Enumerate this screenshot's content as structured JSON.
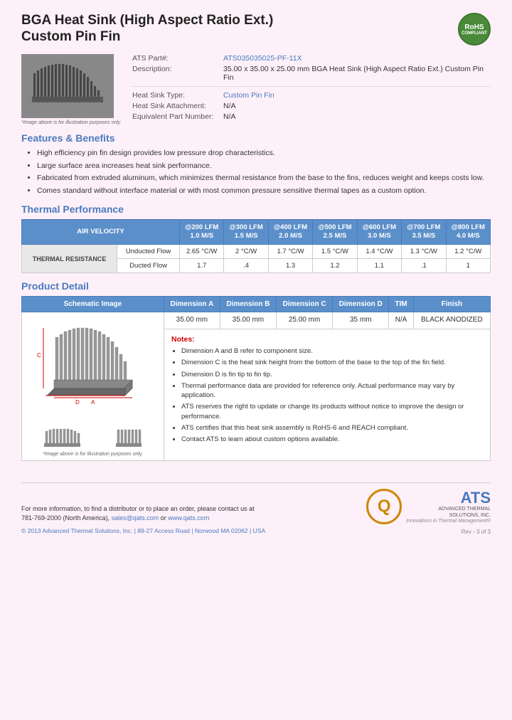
{
  "page": {
    "title_line1": "BGA Heat Sink (High Aspect Ratio Ext.)",
    "title_line2": "Custom Pin Fin"
  },
  "rohs": {
    "line1": "RoHS",
    "line2": "COMPLIANT"
  },
  "product": {
    "part_label": "ATS Part#:",
    "part_value": "ATS035035025-PF-11X",
    "desc_label": "Description:",
    "desc_value": "35.00 x 35.00 x 25.00 mm  BGA Heat Sink (High Aspect Ratio Ext.) Custom Pin Fin",
    "type_label": "Heat Sink Type:",
    "type_value": "Custom Pin Fin",
    "attachment_label": "Heat Sink Attachment:",
    "attachment_value": "N/A",
    "equiv_label": "Equivalent Part Number:",
    "equiv_value": "N/A"
  },
  "image_caption": "*Image above is for illustration purposes only",
  "features": {
    "title": "Features & Benefits",
    "items": [
      "High efficiency pin fin design provides low pressure drop characteristics.",
      "Large surface area increases heat sink performance.",
      "Fabricated from extruded aluminum, which minimizes thermal resistance from the base to the fins, reduces weight and keeps costs low.",
      "Comes standard without interface material or with most common pressure sensitive thermal tapes as a custom option."
    ]
  },
  "thermal": {
    "title": "Thermal Performance",
    "air_velocity_label": "AIR VELOCITY",
    "columns": [
      {
        "label": "@200 LFM",
        "sub": "1.0 M/S"
      },
      {
        "label": "@300 LFM",
        "sub": "1.5 M/S"
      },
      {
        "label": "@400 LFM",
        "sub": "2.0 M/S"
      },
      {
        "label": "@500 LFM",
        "sub": "2.5 M/S"
      },
      {
        "label": "@600 LFM",
        "sub": "3.0 M/S"
      },
      {
        "label": "@700 LFM",
        "sub": "3.5 M/S"
      },
      {
        "label": "@800 LFM",
        "sub": "4.0 M/S"
      }
    ],
    "row_label": "THERMAL RESISTANCE",
    "subrow1_label": "Unducted Flow",
    "subrow1_values": [
      "2.65 °C/W",
      "2 °C/W",
      "1.7 °C/W",
      "1.5 °C/W",
      "1.4 °C/W",
      "1.3 °C/W",
      "1.2 °C/W"
    ],
    "subrow2_label": "Ducted Flow",
    "subrow2_values": [
      "1.7",
      ".4",
      "1.3",
      "1.2",
      "1.1",
      ".1",
      "1"
    ]
  },
  "product_detail": {
    "title": "Product Detail",
    "headers": [
      "Schematic Image",
      "Dimension A",
      "Dimension B",
      "Dimension C",
      "Dimension D",
      "TIM",
      "Finish"
    ],
    "values": [
      "35.00 mm",
      "35.00 mm",
      "25.00 mm",
      "35 mm",
      "N/A",
      "BLACK ANODIZED"
    ],
    "schematic_caption": "*Image above is for illustration purposes only.",
    "notes_title": "Notes:",
    "notes": [
      "Dimension A and B refer to component size.",
      "Dimension C is the heat sink height from the bottom of the base to the top of the fin field.",
      "Dimension D is fin tip to fin tip.",
      "Thermal performance data are provided for reference only. Actual performance may vary by application.",
      "ATS reserves the right to update or change its products without notice to improve the design or performance.",
      "ATS certifies that this heat sink assembly is RoHS-6 and REACH compliant.",
      "Contact ATS to learn about custom options available."
    ]
  },
  "footer": {
    "contact_text": "For more information, to find a distributor or to place an order, please contact us at",
    "phone": "781-769-2000 (North America),",
    "email": "sales@qats.com",
    "or": "or",
    "website": "www.qats.com",
    "copyright": "© 2013 Advanced Thermal Solutions, Inc.",
    "address": "| 89-27 Access Road  |  Norwood MA  02062  |  USA",
    "ats_name": "ATS",
    "ats_full": "ADVANCED\nTHERMAL\nSOLUTIONS, INC.",
    "tagline": "Innovations in Thermal Management®",
    "page_num": "Rev - 3 of 3"
  }
}
